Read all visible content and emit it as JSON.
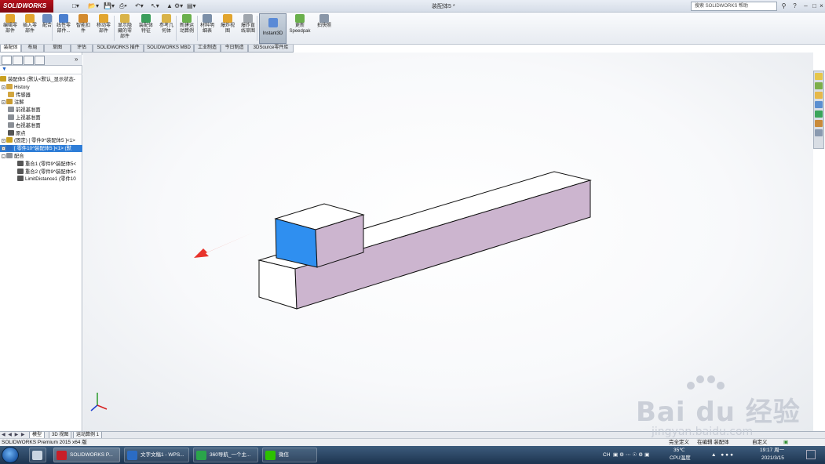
{
  "app": {
    "brand": "SOLIDWORKS",
    "document_title": "装配体5 *",
    "help_search_placeholder": "搜索 SOLIDWORKS 帮助",
    "edition": "SOLIDWORKS Premium 2015 x64 版"
  },
  "ribbon": {
    "buttons": [
      {
        "label": "编辑零\n部件",
        "icon": "edit-component-icon"
      },
      {
        "label": "插入零\n部件",
        "icon": "insert-component-icon"
      },
      {
        "label": "配合",
        "icon": "mate-icon"
      },
      {
        "label": "线性零\n部件...",
        "icon": "linear-pattern-icon"
      },
      {
        "label": "智能扣\n件",
        "icon": "smart-fastener-icon"
      },
      {
        "label": "移动零\n部件",
        "icon": "move-component-icon"
      },
      {
        "label": "显示隐\n藏的零\n部件",
        "icon": "show-hidden-icon"
      },
      {
        "label": "装配体\n特征",
        "icon": "assembly-feature-icon"
      },
      {
        "label": "参考几\n何体",
        "icon": "reference-geometry-icon"
      },
      {
        "label": "新建运\n动算例",
        "icon": "motion-study-icon"
      },
      {
        "label": "材料明\n细表",
        "icon": "bom-icon"
      },
      {
        "label": "爆炸视\n图",
        "icon": "exploded-view-icon"
      },
      {
        "label": "爆炸直\n线草图",
        "icon": "explode-line-icon"
      },
      {
        "label": "Instant3D",
        "icon": "instant3d-icon"
      },
      {
        "label": "更新\nSpeedpak",
        "icon": "speedpak-icon"
      },
      {
        "label": "拍快照",
        "icon": "snapshot-icon"
      }
    ]
  },
  "command_tabs": [
    "装配体",
    "布局",
    "草图",
    "评估",
    "SOLIDWORKS 插件",
    "SOLIDWORKS MBD",
    "工业制造",
    "今日制造",
    "3DSource零件库"
  ],
  "feature_tree": {
    "items": [
      {
        "label": "装配体5  (默认<默认_显示状态-",
        "indent": 0,
        "expander": "",
        "color": "#c9a020"
      },
      {
        "label": "History",
        "indent": 1,
        "expander": "+",
        "color": "#d2a640"
      },
      {
        "label": "传感器",
        "indent": 1,
        "expander": "",
        "color": "#d2a640"
      },
      {
        "label": "注解",
        "indent": 1,
        "expander": "+",
        "color": "#c89a30"
      },
      {
        "label": "前视基准面",
        "indent": 1,
        "expander": "",
        "color": "#8a8f96"
      },
      {
        "label": "上视基准面",
        "indent": 1,
        "expander": "",
        "color": "#8a8f96"
      },
      {
        "label": "右视基准面",
        "indent": 1,
        "expander": "",
        "color": "#8a8f96"
      },
      {
        "label": "原点",
        "indent": 1,
        "expander": "",
        "color": "#555"
      },
      {
        "label": "(固定) [ 零件9^装配体5 ]<1>",
        "indent": 1,
        "expander": "+",
        "color": "#c9a020"
      },
      {
        "label": "[ 零件10^装配体5 ]<1> (默",
        "indent": 1,
        "expander": "+",
        "color": "#2b6cc4",
        "selected": true
      },
      {
        "label": "配合",
        "indent": 1,
        "expander": "-",
        "color": "#8b8f96"
      },
      {
        "label": "重合1 (零件9^装配体5<",
        "indent": 2,
        "expander": "",
        "color": "#555"
      },
      {
        "label": "重合2 (零件9^装配体5<",
        "indent": 2,
        "expander": "",
        "color": "#555"
      },
      {
        "label": "LimitDistance1 (零件10",
        "indent": 2,
        "expander": "",
        "color": "#555"
      }
    ]
  },
  "model_tabs": [
    "模型",
    "3D 视图",
    "运动算例 1"
  ],
  "status_bar": {
    "left": "SOLIDWORKS Premium 2015 x64 版",
    "right_items": [
      "完全定义",
      "在编辑 装配体",
      "自定义"
    ]
  },
  "taskbar": {
    "items": [
      {
        "label": "SOLIDWORKS P...",
        "color": "#c81e28"
      },
      {
        "label": "文字文稿1 - WPS...",
        "color": "#2b6cc4"
      },
      {
        "label": "360导航_一个主...",
        "color": "#2aa54a"
      },
      {
        "label": "微信",
        "color": "#2dc100"
      }
    ],
    "temperature": "35℃",
    "temperature_label": "CPU温度",
    "ime": "CH",
    "time": "19:17 周一",
    "date": "2021/3/15"
  },
  "watermark": {
    "brand": "Bai du 经验",
    "url": "jingyan.baidu.com"
  },
  "colors": {
    "face_selected": "#2f8ff0",
    "face_side": "#ccb5cf",
    "arrow": "#e8342c",
    "tree_selected": "#2e7dd7"
  }
}
